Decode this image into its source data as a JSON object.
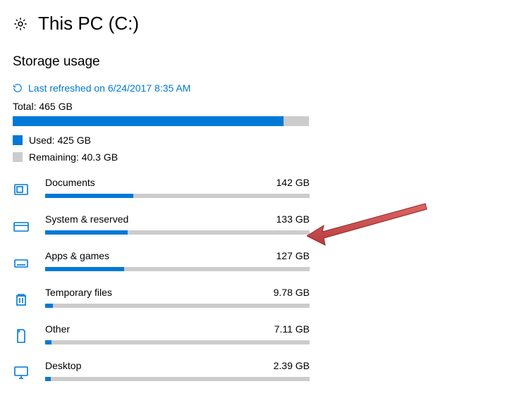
{
  "header": {
    "title": "This PC (C:)"
  },
  "sectionTitle": "Storage usage",
  "refresh": {
    "label": "Last refreshed on 6/24/2017 8:35 AM"
  },
  "total": {
    "label": "Total: 465 GB",
    "usedPct": 91.4
  },
  "legend": {
    "used": "Used: 425 GB",
    "remaining": "Remaining: 40.3 GB"
  },
  "categories": [
    {
      "name": "Documents",
      "size": "142 GB",
      "pct": 33.4,
      "icon": "documents"
    },
    {
      "name": "System & reserved",
      "size": "133 GB",
      "pct": 31.3,
      "icon": "system"
    },
    {
      "name": "Apps & games",
      "size": "127 GB",
      "pct": 29.9,
      "icon": "apps"
    },
    {
      "name": "Temporary files",
      "size": "9.78 GB",
      "pct": 3.0,
      "icon": "trash"
    },
    {
      "name": "Other",
      "size": "7.11 GB",
      "pct": 2.5,
      "icon": "other"
    },
    {
      "name": "Desktop",
      "size": "2.39 GB",
      "pct": 2.0,
      "icon": "desktop"
    }
  ]
}
